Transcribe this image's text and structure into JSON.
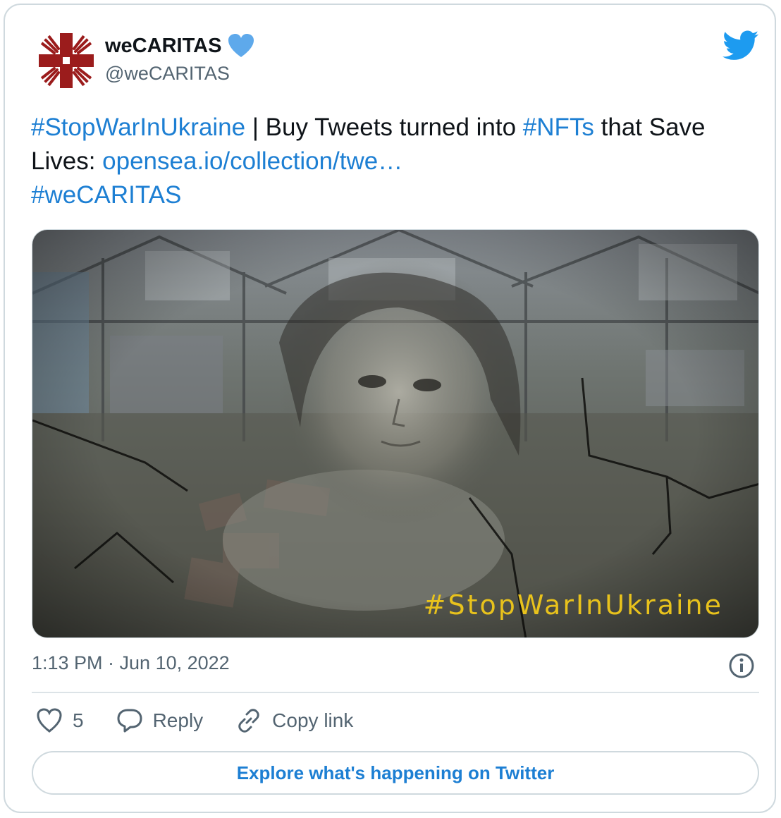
{
  "tweet": {
    "display_name": "weCARITAS",
    "handle": "@weCARITAS",
    "text": {
      "hashtag1": "#StopWarInUkraine",
      "part1": " | Buy Tweets turned into ",
      "hashtag2": "#NFTs",
      "part2": " that Save Lives: ",
      "link": "opensea.io/collection/twe…",
      "hashtag3": "#weCARITAS"
    },
    "image_overlay_text": "#StopWarInUkraine",
    "timestamp": "1:13 PM · Jun 10, 2022"
  },
  "actions": {
    "like_count": "5",
    "reply_label": "Reply",
    "copy_link_label": "Copy link"
  },
  "explore_button": "Explore what's happening on Twitter",
  "colors": {
    "link_blue": "#1d7fd3",
    "twitter_blue": "#1d9bf0",
    "verified_blue": "#5ea9eb",
    "caritas_red": "#9b1c1c",
    "overlay_yellow": "#e8c21c"
  },
  "icons": [
    "caritas-logo",
    "verified-heart-icon",
    "twitter-bird-icon",
    "info-icon",
    "heart-icon",
    "reply-bubble-icon",
    "link-icon"
  ]
}
